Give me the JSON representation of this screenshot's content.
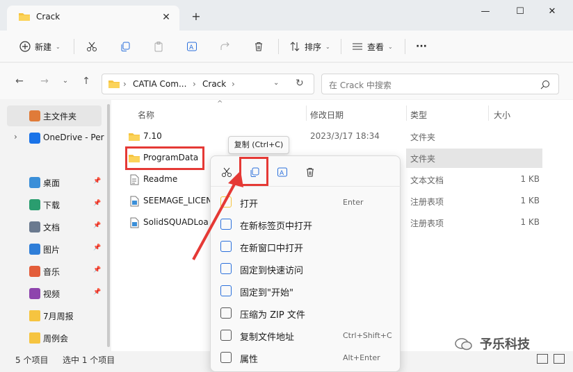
{
  "window": {
    "tab_title": "Crack",
    "colors": {
      "accent": "#e53935",
      "folder": "#f6c440",
      "link_blue": "#1a73e8"
    }
  },
  "toolbar": {
    "new_label": "新建",
    "sort_label": "排序",
    "view_label": "查看",
    "more_label": "···"
  },
  "address": {
    "crumbs": [
      "CATIA Com...",
      "Crack"
    ],
    "search_placeholder": "在 Crack 中搜索"
  },
  "sidebar": {
    "items": [
      {
        "label": "主文件夹",
        "icon": "home-icon",
        "pinned": false
      },
      {
        "label": "OneDrive - Per",
        "icon": "cloud-icon",
        "pinned": false
      },
      {
        "label": "桌面",
        "icon": "desktop-icon",
        "pinned": true
      },
      {
        "label": "下载",
        "icon": "download-icon",
        "pinned": true
      },
      {
        "label": "文档",
        "icon": "document-icon",
        "pinned": true
      },
      {
        "label": "图片",
        "icon": "pictures-icon",
        "pinned": true
      },
      {
        "label": "音乐",
        "icon": "music-icon",
        "pinned": true
      },
      {
        "label": "视频",
        "icon": "video-icon",
        "pinned": true
      },
      {
        "label": "7月周报",
        "icon": "folder-icon",
        "pinned": false
      },
      {
        "label": "周例会",
        "icon": "folder-icon",
        "pinned": false
      }
    ]
  },
  "columns": {
    "name": "名称",
    "date": "修改日期",
    "type": "类型",
    "size": "大小"
  },
  "files": [
    {
      "name": "7.10",
      "date": "2023/3/17 18:34",
      "type": "文件夹",
      "size": "",
      "icon": "folder-icon"
    },
    {
      "name": "ProgramData",
      "date": "",
      "type": "文件夹",
      "size": "",
      "icon": "folder-icon"
    },
    {
      "name": "Readme",
      "date": "",
      "type": "文本文档",
      "size": "1 KB",
      "icon": "text-file-icon"
    },
    {
      "name": "SEEMAGE_LICEN",
      "date": "",
      "type": "注册表项",
      "size": "1 KB",
      "icon": "registry-icon"
    },
    {
      "name": "SolidSQUADLoa",
      "date": "",
      "type": "注册表项",
      "size": "1 KB",
      "icon": "registry-icon"
    }
  ],
  "tooltip": "复制 (Ctrl+C)",
  "context_menu": {
    "items": [
      {
        "label": "打开",
        "shortcut": "Enter",
        "icon": "folder-open-icon"
      },
      {
        "label": "在新标签页中打开",
        "shortcut": "",
        "icon": "new-tab-icon"
      },
      {
        "label": "在新窗口中打开",
        "shortcut": "",
        "icon": "new-window-icon"
      },
      {
        "label": "固定到快速访问",
        "shortcut": "",
        "icon": "pin-icon"
      },
      {
        "label": "固定到\"开始\"",
        "shortcut": "",
        "icon": "pin-icon"
      },
      {
        "label": "压缩为 ZIP 文件",
        "shortcut": "",
        "icon": "zip-icon"
      },
      {
        "label": "复制文件地址",
        "shortcut": "Ctrl+Shift+C",
        "icon": "copy-path-icon"
      },
      {
        "label": "属性",
        "shortcut": "Alt+Enter",
        "icon": "wrench-icon"
      }
    ]
  },
  "status": {
    "count": "5 个项目",
    "selected": "选中 1 个项目"
  },
  "watermark": "予乐科技"
}
